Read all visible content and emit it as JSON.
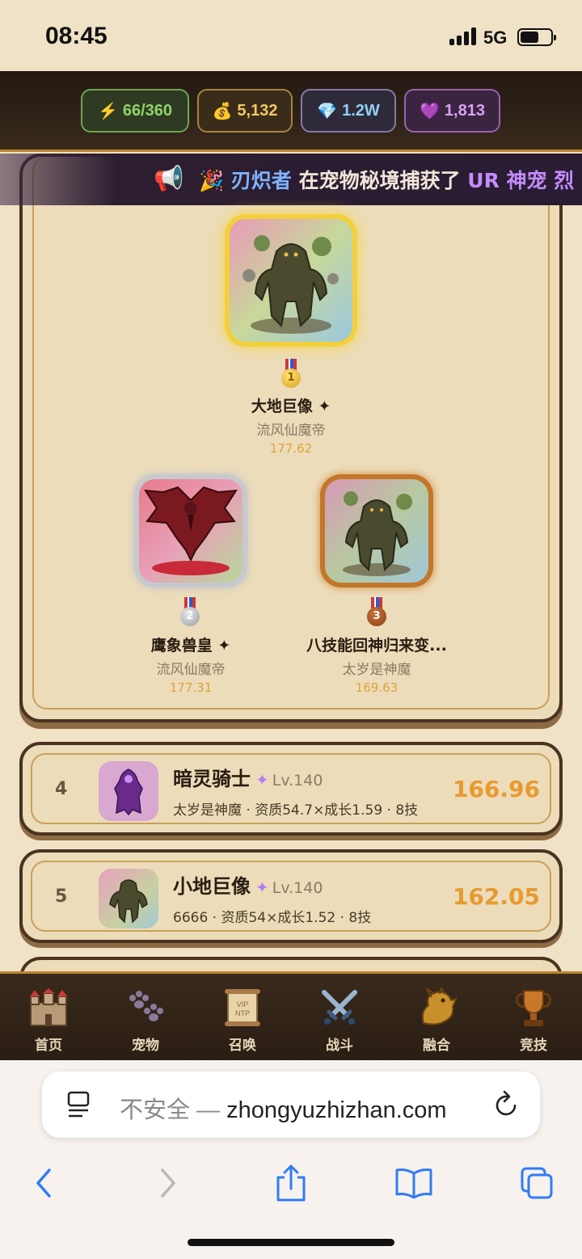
{
  "status_bar": {
    "time": "08:45",
    "network": "5G",
    "battery_level": 0.6
  },
  "resources": {
    "energy": {
      "icon": "lightning-icon",
      "value": "66/360"
    },
    "coins": {
      "icon": "money-bag-icon",
      "value": "5,132"
    },
    "gems": {
      "icon": "diamond-icon",
      "value": "1.2W"
    },
    "hearts": {
      "icon": "purple-heart-icon",
      "value": "1,813"
    }
  },
  "announcement": {
    "icon": "megaphone-icon",
    "party_icon": "party-popper-icon",
    "player": "刃炽者",
    "action": " 在宠物秘境捕获了 ",
    "rarity": "UR 神宠 烈"
  },
  "podium": [
    {
      "rank": "1",
      "name": "大地巨像 ✦",
      "owner": "流风仙魔帝",
      "score": "177.62",
      "medal": "gold"
    },
    {
      "rank": "2",
      "name": "鹰象兽皇 ✦",
      "owner": "流风仙魔帝",
      "score": "177.31",
      "medal": "silver"
    },
    {
      "rank": "3",
      "name": "八技能回神归来变...",
      "owner": "太岁是神魔",
      "score": "169.63",
      "medal": "bronze"
    }
  ],
  "ranking_list": [
    {
      "rank": "4",
      "name": "暗灵骑士",
      "star": "✦",
      "level": "Lv.140",
      "meta": "太岁是神魔 · 资质54.7×成长1.59 · 8技",
      "score": "166.96"
    },
    {
      "rank": "5",
      "name": "小地巨像",
      "star": "✦",
      "level": "Lv.140",
      "meta": "6666 · 资质54×成长1.52 · 8技",
      "score": "162.05"
    }
  ],
  "bottom_nav": [
    {
      "label": "首页",
      "icon": "castle-icon"
    },
    {
      "label": "宠物",
      "icon": "paw-icon"
    },
    {
      "label": "召唤",
      "icon": "scroll-icon"
    },
    {
      "label": "战斗",
      "icon": "crossed-swords-icon"
    },
    {
      "label": "融合",
      "icon": "dragon-icon"
    },
    {
      "label": "竞技",
      "icon": "trophy-icon"
    }
  ],
  "browser": {
    "security": "不安全 — ",
    "domain": "zhongyuzhizhan.com"
  }
}
